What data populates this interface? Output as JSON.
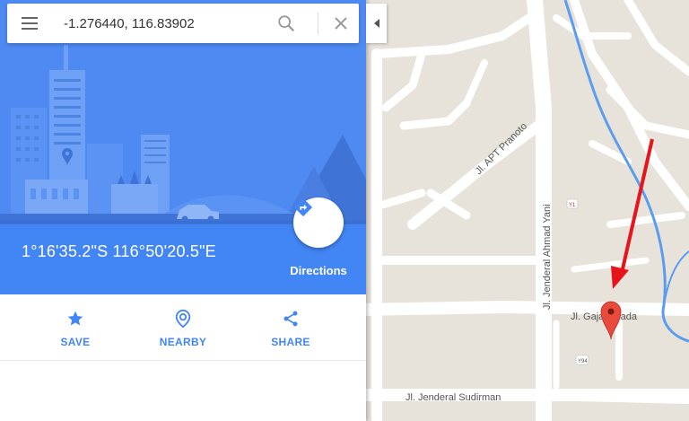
{
  "search": {
    "value": "-1.276440, 116.83902",
    "menu_icon": "menu-icon",
    "search_icon": "search-icon",
    "clear_icon": "close-icon"
  },
  "place": {
    "coordinates": "1°16'35.2\"S 116°50'20.5\"E",
    "directions_label": "Directions",
    "directions_icon": "directions-icon"
  },
  "actions": [
    {
      "label": "SAVE",
      "icon": "star-icon"
    },
    {
      "label": "NEARBY",
      "icon": "nearby-icon"
    },
    {
      "label": "SHARE",
      "icon": "share-icon"
    }
  ],
  "map": {
    "streets": [
      "Jl. APT Pranoto",
      "Jl. Jenderal Ahmad Yani",
      "Jl. Gajah Mada",
      "Jl. Jenderal Sudirman"
    ],
    "poi_badges": [
      "Y1",
      "Y94"
    ],
    "colors": {
      "panel_blue": "#4e8af2",
      "accent": "#4285f4",
      "marker": "#e84a3b",
      "arrow": "#e8141c",
      "water": "#5a9cf0",
      "land": "#e8e3da",
      "road": "#ffffff"
    }
  }
}
